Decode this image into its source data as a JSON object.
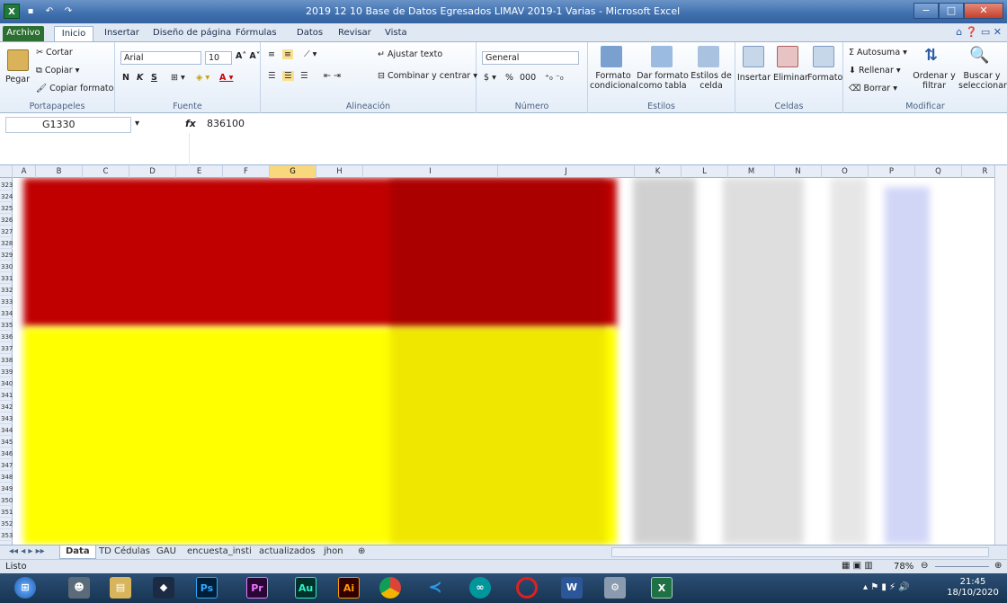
{
  "window": {
    "title": "2019 12 10 Base de Datos Egresados LIMAV 2019-1 Varias - Microsoft Excel",
    "minimize": "−",
    "maximize": "□",
    "close": "✕"
  },
  "tabs": [
    "Archivo",
    "Inicio",
    "Insertar",
    "Diseño de página",
    "Fórmulas",
    "Datos",
    "Revisar",
    "Vista"
  ],
  "ribbon": {
    "portapapeles": {
      "paste": "Pegar",
      "cut": "Cortar",
      "copy": "Copiar",
      "format_painter": "Copiar formato",
      "label": "Portapapeles"
    },
    "fuente": {
      "font": "Arial",
      "size": "10",
      "bold": "N",
      "italic": "K",
      "underline": "S",
      "label": "Fuente"
    },
    "alineacion": {
      "wrap": "Ajustar texto",
      "merge": "Combinar y centrar",
      "label": "Alineación"
    },
    "numero": {
      "format": "General",
      "percent": "%",
      "thousands": "000",
      "label": "Número"
    },
    "estilos": {
      "cond": "Formato condicional",
      "table": "Dar formato como tabla",
      "cell": "Estilos de celda",
      "label": "Estilos"
    },
    "celdas": {
      "insert": "Insertar",
      "delete": "Eliminar",
      "format": "Formato",
      "label": "Celdas"
    },
    "modificar": {
      "autosum": "Autosuma",
      "fill": "Rellenar",
      "clear": "Borrar",
      "sort": "Ordenar y filtrar",
      "find": "Buscar y seleccionar",
      "label": "Modificar"
    }
  },
  "formula_bar": {
    "name_box": "G1330",
    "fx": "fx",
    "value": "836100"
  },
  "columns": [
    "A",
    "B",
    "C",
    "D",
    "E",
    "F",
    "G",
    "H",
    "I",
    "J",
    "K",
    "L",
    "M",
    "N",
    "O",
    "P",
    "Q",
    "R"
  ],
  "rows": [
    "323",
    "324",
    "325",
    "326",
    "327",
    "328",
    "329",
    "330",
    "331",
    "332",
    "333",
    "334",
    "335",
    "336",
    "337",
    "338",
    "339",
    "340",
    "341",
    "342",
    "343",
    "344",
    "345",
    "346",
    "347",
    "348",
    "349",
    "350",
    "351",
    "352",
    "353"
  ],
  "sheet_tabs": [
    "Data",
    "TD Cédulas",
    "GAU",
    "encuesta_insti",
    "actualizados",
    "jhon"
  ],
  "status": {
    "ready": "Listo",
    "zoom": "78%"
  },
  "taskbar": {
    "apps": [
      "Ps",
      "Pr",
      "Au",
      "Ai",
      "W",
      "X"
    ],
    "time": "21:45",
    "date": "18/10/2020"
  },
  "colors": {
    "red_fill": "#c00000",
    "yellow_fill": "#ffff00",
    "selected_header": "#f9d77d"
  }
}
